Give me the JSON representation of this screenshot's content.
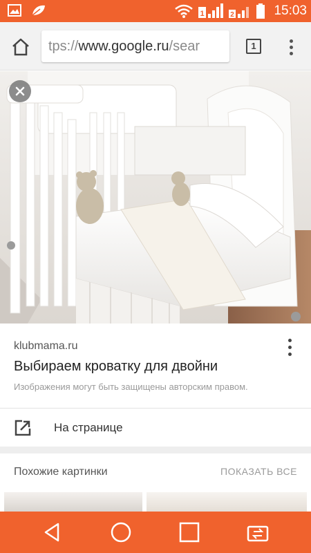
{
  "status_bar": {
    "time": "15:03",
    "color": "#f0622d",
    "left_icons": [
      "image-icon",
      "leaf-icon"
    ],
    "right_icons": [
      "wifi-icon",
      "signal-sim1-icon",
      "signal-sim2-icon",
      "battery-icon"
    ]
  },
  "browser": {
    "url_scheme": "tps://",
    "url_host": "www.google.ru",
    "url_path": "/sear",
    "tab_count": "1"
  },
  "result": {
    "source": "klubmama.ru",
    "title": "Выбираем кроватку для двойни",
    "copyright_notice": "Изображения могут быть защищены авторским правом."
  },
  "actions": {
    "on_page_label": "На странице"
  },
  "similar": {
    "title": "Похожие картинки",
    "show_all_label": "ПОКАЗАТЬ ВСЕ"
  },
  "nav_bar": {
    "buttons": [
      "back-icon",
      "home-icon",
      "recents-icon",
      "switch-icon"
    ]
  }
}
